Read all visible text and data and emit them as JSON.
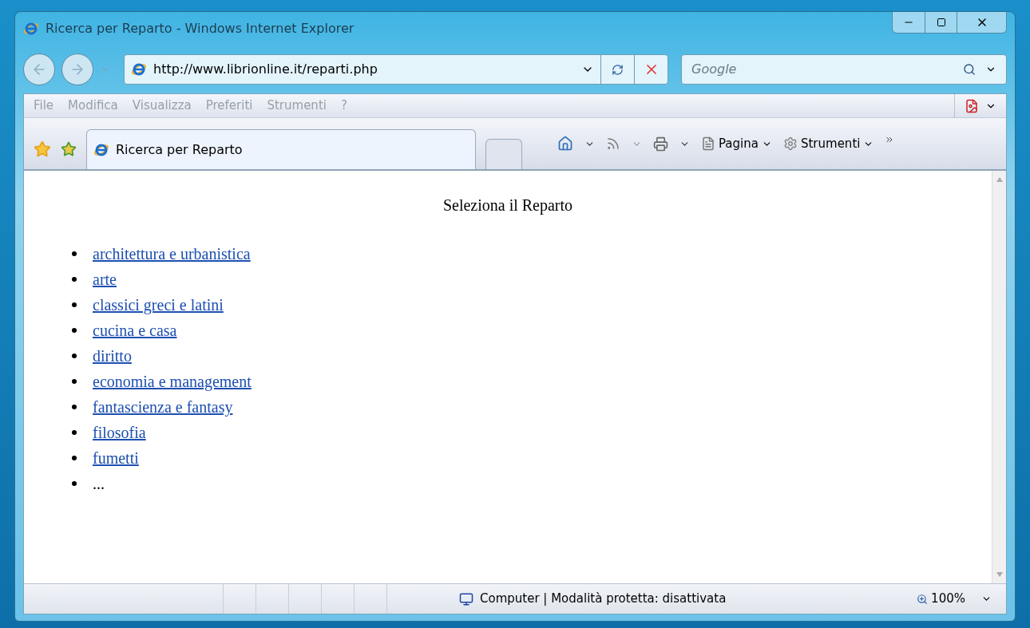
{
  "window": {
    "title": "Ricerca per Reparto - Windows Internet Explorer"
  },
  "address_bar": {
    "value": "http://www.librionline.it/reparti.php"
  },
  "search": {
    "placeholder": "Google"
  },
  "menu": [
    "File",
    "Modifica",
    "Visualizza",
    "Preferiti",
    "Strumenti",
    "?"
  ],
  "tabs": [
    {
      "label": "Ricerca per Reparto",
      "selected": true
    }
  ],
  "command_bar": [
    "Pagina",
    "Strumenti"
  ],
  "page": {
    "heading": "Seleziona il Reparto",
    "items": [
      {
        "kind": "link",
        "text": "architettura e urbanistica"
      },
      {
        "kind": "link",
        "text": "arte"
      },
      {
        "kind": "link",
        "text": "classici greci e latini"
      },
      {
        "kind": "link",
        "text": "cucina e casa"
      },
      {
        "kind": "link",
        "text": "diritto"
      },
      {
        "kind": "link",
        "text": "economia e management"
      },
      {
        "kind": "link",
        "text": "fantascienza e fantasy"
      },
      {
        "kind": "link",
        "text": "filosofia"
      },
      {
        "kind": "link",
        "text": "fumetti"
      },
      {
        "kind": "text",
        "text": "..."
      }
    ]
  },
  "status_bar": {
    "zone": "Computer | Modalità protetta: disattivata",
    "zoom": "100%"
  }
}
